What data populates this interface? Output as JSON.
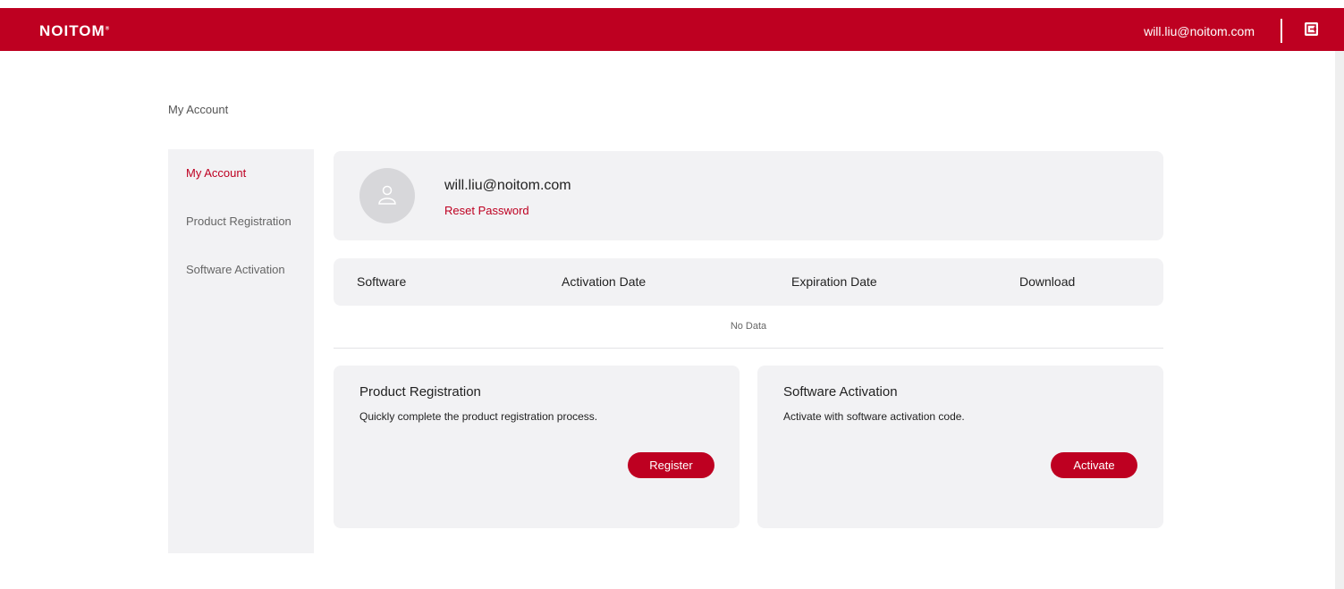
{
  "header": {
    "logo": "NOITOM",
    "logo_mark": "®",
    "user_email": "will.liu@noitom.com",
    "logout_icon": "logout-icon"
  },
  "breadcrumb": "My Account",
  "sidebar": {
    "items": [
      {
        "label": "My Account",
        "active": true
      },
      {
        "label": "Product Registration",
        "active": false
      },
      {
        "label": "Software Activation",
        "active": false
      }
    ]
  },
  "profile": {
    "avatar_icon": "user-icon",
    "email": "will.liu@noitom.com",
    "reset_label": "Reset Password"
  },
  "table": {
    "columns": [
      "Software",
      "Activation Date",
      "Expiration Date",
      "Download"
    ],
    "rows": [],
    "empty_text": "No Data"
  },
  "cards": [
    {
      "title": "Product Registration",
      "description": "Quickly complete the product registration process.",
      "button": "Register"
    },
    {
      "title": "Software Activation",
      "description": "Activate with software activation code.",
      "button": "Activate"
    }
  ],
  "colors": {
    "brand": "#be0021",
    "panel": "#f2f2f4"
  }
}
